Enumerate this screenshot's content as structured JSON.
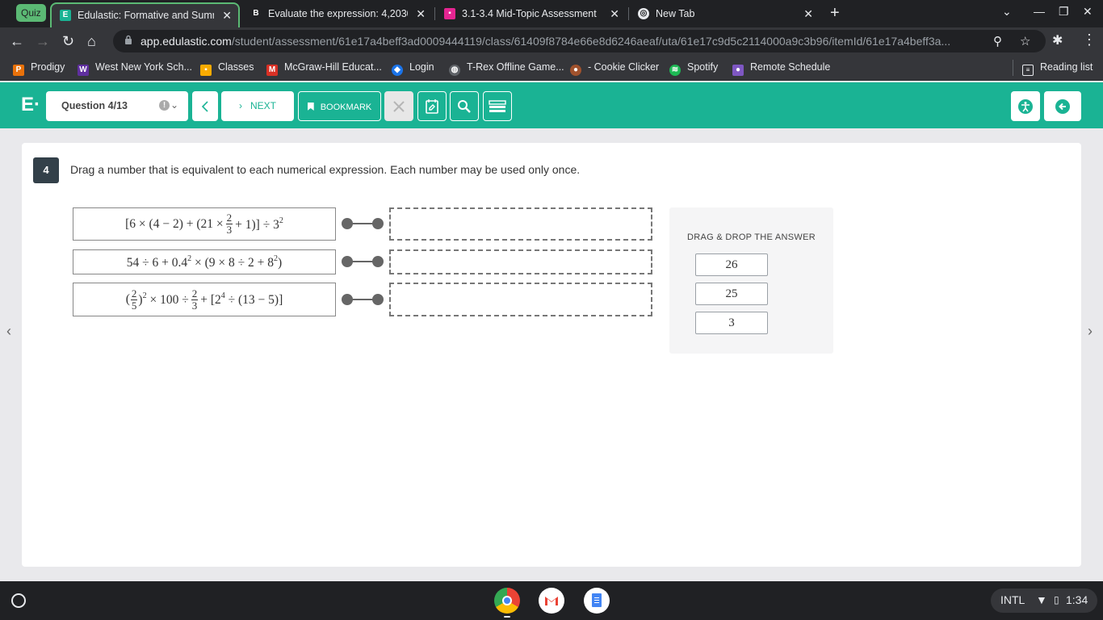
{
  "browser": {
    "tab_group_label": "Quiz",
    "tabs": [
      {
        "title": "Edulastic: Formative and Summ",
        "icon": "edulastic-icon",
        "active": true
      },
      {
        "title": "Evaluate the expression: 4,2030",
        "icon": "brainly-icon",
        "active": false
      },
      {
        "title": "3.1-3.4 Mid-Topic Assessment",
        "icon": "classroom-icon",
        "active": false
      },
      {
        "title": "New Tab",
        "icon": "chrome-icon",
        "active": false
      }
    ],
    "url_host": "app.edulastic.com",
    "url_path": "/student/assessment/61e17a4beff3ad0009444119/class/61409f8784e66e8d6246aeaf/uta/61e17c9d5c2114000a9c3b96/itemId/61e17a4beff3a..."
  },
  "bookmarks": [
    {
      "label": "Prodigy",
      "color": "#e8710a",
      "icon": "prodigy-icon"
    },
    {
      "label": "West New York Sch...",
      "color": "#5f2f9f",
      "icon": "school-icon"
    },
    {
      "label": "Classes",
      "color": "#f9ab00",
      "icon": "classroom-icon"
    },
    {
      "label": "McGraw-Hill Educat...",
      "color": "#d93025",
      "icon": "mcgraw-hill-icon"
    },
    {
      "label": "Login",
      "color": "#1a73e8",
      "icon": "login-icon"
    },
    {
      "label": "T-Rex Offline Game...",
      "color": "#9aa0a6",
      "icon": "globe-icon"
    },
    {
      "label": "- Cookie Clicker",
      "color": "#a0522d",
      "icon": "cookie-icon"
    },
    {
      "label": "Spotify",
      "color": "#1db954",
      "icon": "spotify-icon"
    },
    {
      "label": "Remote Schedule",
      "color": "#7e57c2",
      "icon": "person-icon"
    }
  ],
  "reading_list_label": "Reading list",
  "header": {
    "logo": "E·",
    "question_select": "Question 4/13",
    "next_label": "NEXT",
    "bookmark_label": "BOOKMARK",
    "accent": "#1ab394"
  },
  "question": {
    "number": "4",
    "prompt": "Drag a number that is equivalent to each numerical expression. Each number may be used only once.",
    "expressions": [
      "[6 × (4 − 2) + (21 × 2/3 + 1)] ÷ 3^2",
      "54 ÷ 6 + 0.4^2 × (9 × 8 ÷ 2 + 8^2)",
      "(2/5)^2 × 100 ÷ 2/3 + [2^4 ÷ (13 − 5)]"
    ],
    "answers_title": "DRAG & DROP THE ANSWER",
    "answers": [
      "26",
      "25",
      "3"
    ]
  },
  "shelf": {
    "keyboard": "INTL",
    "time": "1:34"
  }
}
